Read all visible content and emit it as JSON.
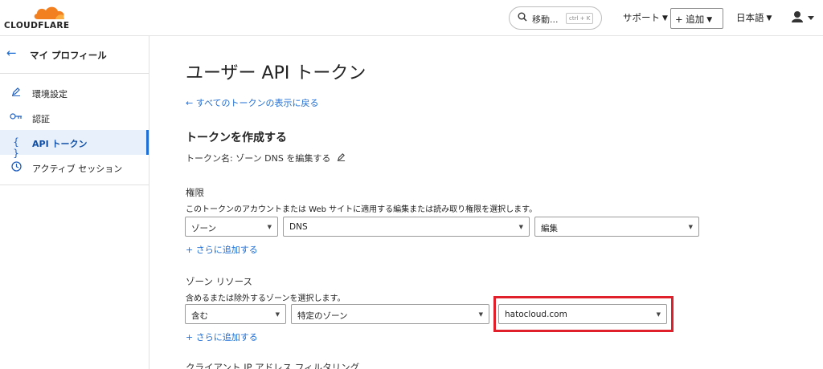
{
  "header": {
    "logo_text": "CLOUDFLARE",
    "search": {
      "label": "移動...",
      "shortcut": "ctrl + K"
    },
    "support_label": "サポート",
    "add_label": "+ 追加",
    "language_label": "日本語",
    "user_icon": "user-icon"
  },
  "sidebar": {
    "title": "マイ プロフィール",
    "items": [
      {
        "label": "環境設定",
        "icon": "pencil-icon"
      },
      {
        "label": "認証",
        "icon": "key-icon"
      },
      {
        "label": "API トークン",
        "icon": "braces-icon",
        "active": true
      },
      {
        "label": "アクティブ セッション",
        "icon": "clock-icon"
      }
    ]
  },
  "main": {
    "page_title": "ユーザー API トークン",
    "back_link": "← すべてのトークンの表示に戻る",
    "section_title": "トークンを作成する",
    "token_name": "トークン名: ゾーン DNS を編集する",
    "permissions": {
      "label": "権限",
      "description": "このトークンのアカウントまたは Web サイトに適用する編集または読み取り権限を選択します。",
      "selects": [
        "ゾーン",
        "DNS",
        "編集"
      ],
      "add_more": "+ さらに追加する"
    },
    "zone_resources": {
      "label": "ゾーン リソース",
      "description": "含めるまたは除外するゾーンを選択します。",
      "selects": [
        "含む",
        "特定のゾーン",
        "hatocloud.com"
      ],
      "add_more": "+ さらに追加する"
    },
    "client_ip_label": "クライアント IP アドレス フィルタリング"
  },
  "colors": {
    "accent": "#1f6ed4",
    "brand_orange": "#f38020",
    "highlight": "#e0202b"
  }
}
